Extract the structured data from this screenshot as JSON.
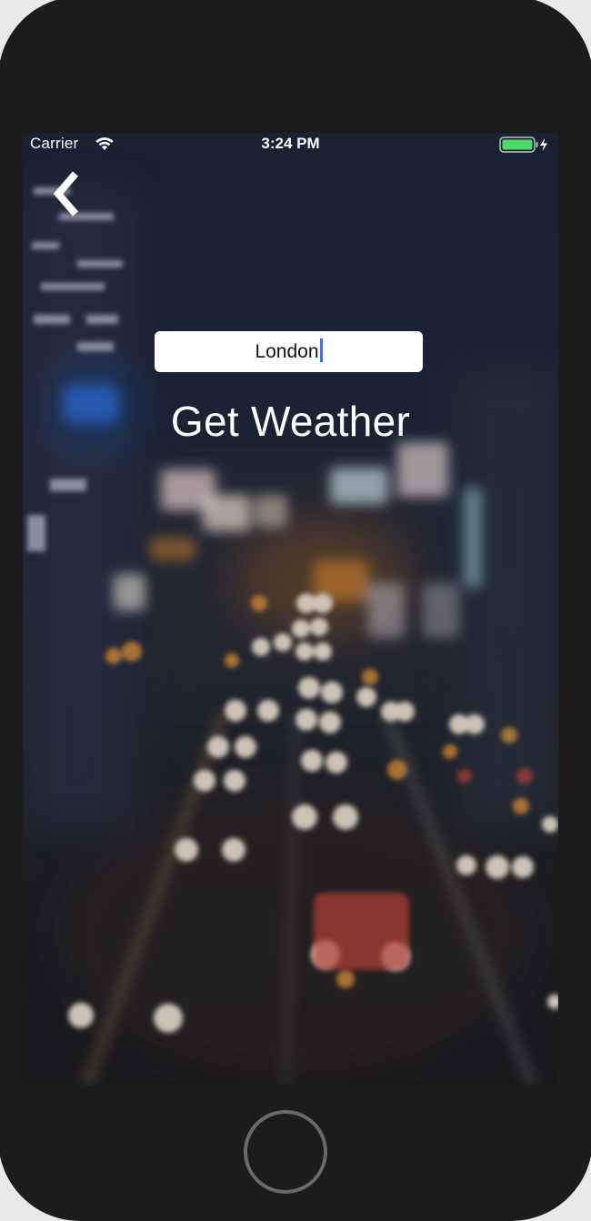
{
  "status_bar": {
    "carrier": "Carrier",
    "time": "3:24 PM",
    "battery_color": "#4cd964"
  },
  "navigation": {
    "back_icon": "chevron-left-icon"
  },
  "search": {
    "value": "London"
  },
  "action": {
    "label": "Get Weather"
  },
  "device": {
    "home_button_icon": "circle-home-icon"
  }
}
